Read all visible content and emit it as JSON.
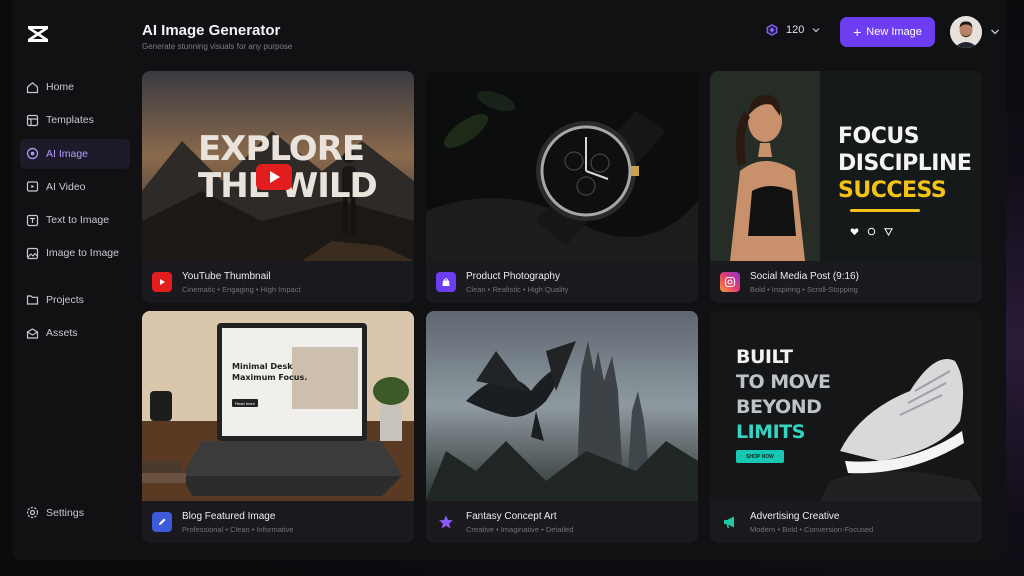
{
  "app": {
    "logo_icon": "capcut-logo-icon"
  },
  "sidebar": {
    "items": [
      {
        "label": "Home",
        "icon": "home-icon",
        "active": false
      },
      {
        "label": "Templates",
        "icon": "templates-icon",
        "active": false
      },
      {
        "label": "AI Image",
        "icon": "ai-image-icon",
        "active": true
      },
      {
        "label": "AI Video",
        "icon": "ai-video-icon",
        "active": false
      },
      {
        "label": "Text to Image",
        "icon": "text-to-image-icon",
        "active": false
      },
      {
        "label": "Image to Image",
        "icon": "image-to-image-icon",
        "active": false
      },
      {
        "label": "Projects",
        "icon": "folder-icon",
        "active": false
      },
      {
        "label": "Assets",
        "icon": "assets-icon",
        "active": false
      }
    ],
    "settings_label": "Settings"
  },
  "header": {
    "title": "AI Image Generator",
    "subtitle": "Generate stunning visuals for any purpose",
    "credits": "120",
    "new_button_label": "New Image"
  },
  "colors": {
    "accent": "#6d3df2",
    "active_nav": "#b69cff",
    "background": "#111114"
  },
  "cards": [
    {
      "name": "YouTube Thumbnail",
      "desc": "Cinematic • Engaging • High Impact",
      "icon": "youtube-icon",
      "overlay": [
        "EXPLORE",
        "THE WILD"
      ]
    },
    {
      "name": "Product Photography",
      "desc": "Clean • Realistic • High Quality",
      "icon": "shopping-bag-icon"
    },
    {
      "name": "Social Media Post (9:16)",
      "desc": "Bold • Inspiring • Scroll-Stopping",
      "icon": "instagram-icon",
      "overlay": [
        "FOCUS",
        "DISCIPLINE",
        "SUCCESS"
      ]
    },
    {
      "name": "Blog Featured Image",
      "desc": "Professional • Clean • Informative",
      "icon": "pencil-icon",
      "overlay": [
        "Minimal Desk",
        "Maximum Focus.",
        "Read more"
      ]
    },
    {
      "name": "Fantasy Concept Art",
      "desc": "Creative • Imaginative • Detailed",
      "icon": "star-icon"
    },
    {
      "name": "Advertising Creative",
      "desc": "Modern • Bold • Conversion-Focused",
      "icon": "megaphone-icon",
      "overlay": [
        "BUILT",
        "TO MOVE",
        "BEYOND",
        "LIMITS",
        "SHOP NOW"
      ]
    }
  ]
}
